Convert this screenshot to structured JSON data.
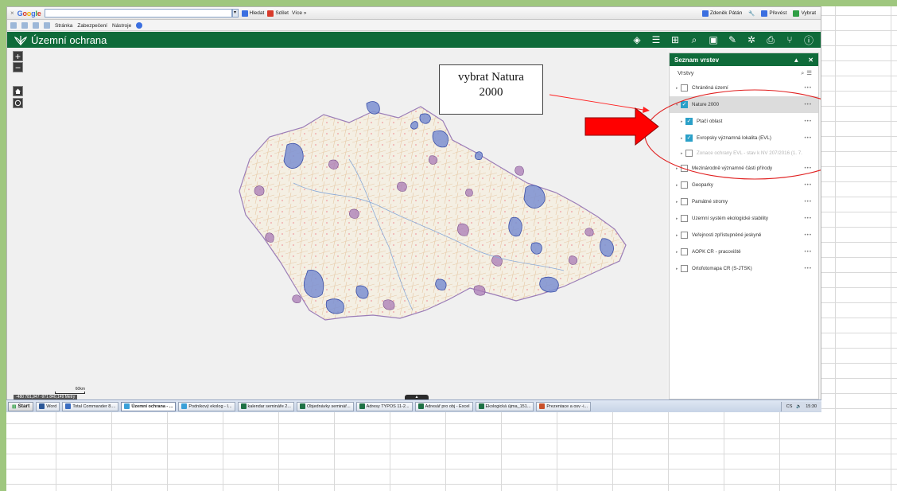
{
  "google_bar": {
    "close": "×",
    "logo": [
      "G",
      "o",
      "o",
      "g",
      "l",
      "e"
    ],
    "search_button": "Hledat",
    "share_button": "Sdílet",
    "more_button": "Více »",
    "user": "Zdeněk Pátán",
    "translate": "Převést",
    "select": "Vybrat"
  },
  "command_bar": {
    "page": "Stránka",
    "security": "Zabezpečení",
    "tools": "Nástroje"
  },
  "app": {
    "title": "Územní ochrana",
    "header_color": "#0f6b3a"
  },
  "map": {
    "zoom_in": "+",
    "zoom_out": "−",
    "scale_label": "60km",
    "coords": "-480 781,947 -971 840,149 Metry",
    "fold": "▲"
  },
  "panel": {
    "title": "Seznam vrstev",
    "subtitle": "Vrstvy",
    "layers": [
      {
        "label": "Chráněná území",
        "checked": false
      },
      {
        "label": "Nature 2000",
        "checked": true
      },
      {
        "label": "Ptačí oblast",
        "checked": true
      },
      {
        "label": "Evropsky významná lokalita (EVL)",
        "checked": true
      },
      {
        "label": "Zonace ochrany EVL - stav k NV 207/2016 (1. 7.",
        "checked": false
      },
      {
        "label": "Mezinárodně významné části přírody",
        "checked": false
      },
      {
        "label": "Geoparky",
        "checked": false
      },
      {
        "label": "Památné stromy",
        "checked": false
      },
      {
        "label": "Územní systém ekologické stability",
        "checked": false
      },
      {
        "label": "Veřejnosti zpřístupněné jeskyně",
        "checked": false
      },
      {
        "label": "AOPK ČR - pracoviště",
        "checked": false
      },
      {
        "label": "Ortofotomapa ČR (S-JTSK)",
        "checked": false
      }
    ],
    "more": "•••"
  },
  "annotation": {
    "line1": "vybrat Natura",
    "line2": "2000",
    "arrow_color": "#ff0000"
  },
  "taskbar": {
    "start": "Start",
    "items": [
      {
        "label": "Word",
        "color": "#2b5797"
      },
      {
        "label": "Total Commander 8....",
        "color": "#3a6cc0"
      },
      {
        "label": "Územní ochrana - ...",
        "color": "#3aa0d8"
      },
      {
        "label": "Podnikový ekolog - I...",
        "color": "#3aa0d8"
      },
      {
        "label": "kalendar semináře 2...",
        "color": "#1e7145"
      },
      {
        "label": "Objednávky seminář...",
        "color": "#1e7145"
      },
      {
        "label": "Adresy TYPOS 11-2...",
        "color": "#1e7145"
      },
      {
        "label": "Adresář pro obj - Excel",
        "color": "#1e7145"
      },
      {
        "label": "Ekologická újma_151...",
        "color": "#1e7145"
      },
      {
        "label": "Prezentace a osv -i...",
        "color": "#c8502a"
      }
    ],
    "lang": "CS",
    "time": "15:30"
  }
}
